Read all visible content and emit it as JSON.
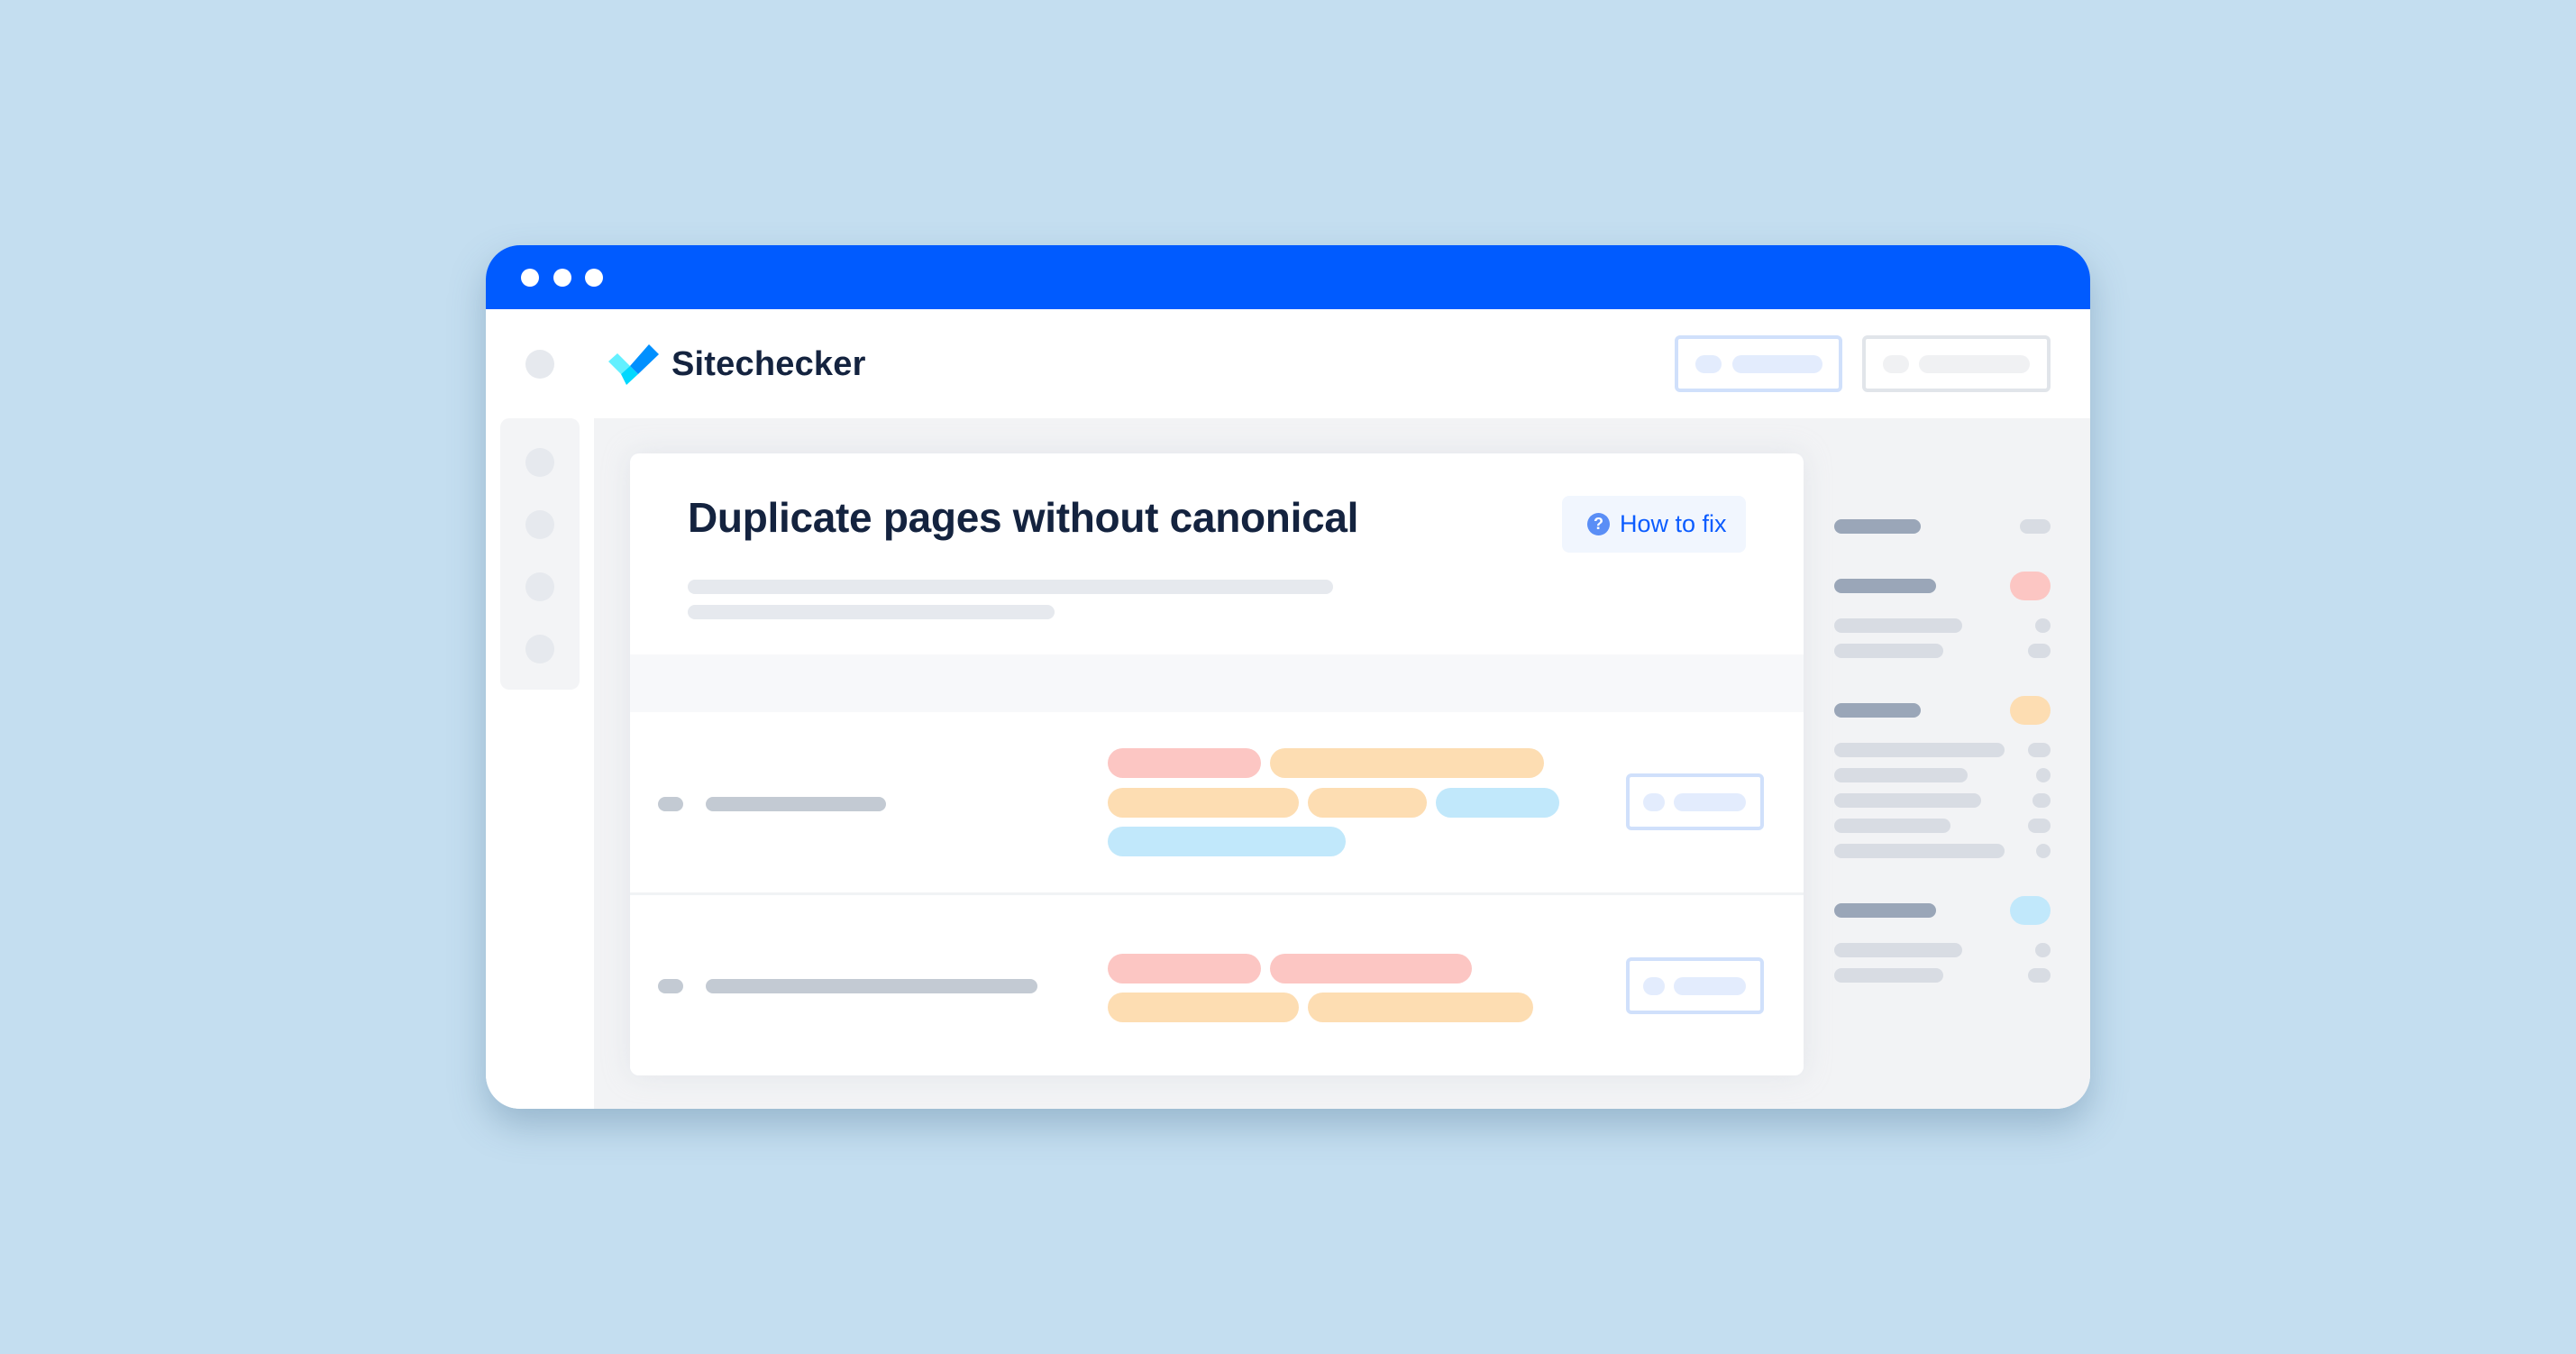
{
  "window": {
    "titlebar_color": "#005bff",
    "titlebar_dots": 3
  },
  "header": {
    "brand": "Sitechecker",
    "logo_icon": "checkmark-logo-icon",
    "buttons": [
      {
        "name": "header-action-button-primary",
        "style": "blue-outline"
      },
      {
        "name": "header-action-button-secondary",
        "style": "gray-outline"
      }
    ]
  },
  "sidebar": {
    "items": [
      "nav-item-1",
      "nav-item-2",
      "nav-item-3",
      "nav-item-4"
    ]
  },
  "issue": {
    "title": "Duplicate pages without canonical",
    "how_to_fix_label": "How to fix",
    "how_to_fix_icon": "question-circle-icon",
    "rows": [
      {
        "tags": [
          [
            "red",
            "orange"
          ],
          [
            "orange",
            "orange",
            "blue"
          ],
          [
            "blue"
          ]
        ]
      },
      {
        "tags": [
          [
            "red",
            "red"
          ],
          [
            "orange",
            "orange"
          ]
        ]
      }
    ]
  },
  "summary_panel": {
    "sections": [
      {
        "badge": "neutral",
        "lines": 0
      },
      {
        "badge": "red",
        "badge_color": "#fcc6c3",
        "lines": 2
      },
      {
        "badge": "orange",
        "badge_color": "#fdddb2",
        "lines": 5
      },
      {
        "badge": "blue",
        "badge_color": "#c1e8fb",
        "lines": 2
      }
    ]
  },
  "colors": {
    "accent": "#005bff",
    "title_text": "#14233f",
    "link_text": "#0b5cff",
    "tag_red": "#fcc6c3",
    "tag_orange": "#fdddb2",
    "tag_blue": "#c1e8fb",
    "background": "#c4def0"
  }
}
